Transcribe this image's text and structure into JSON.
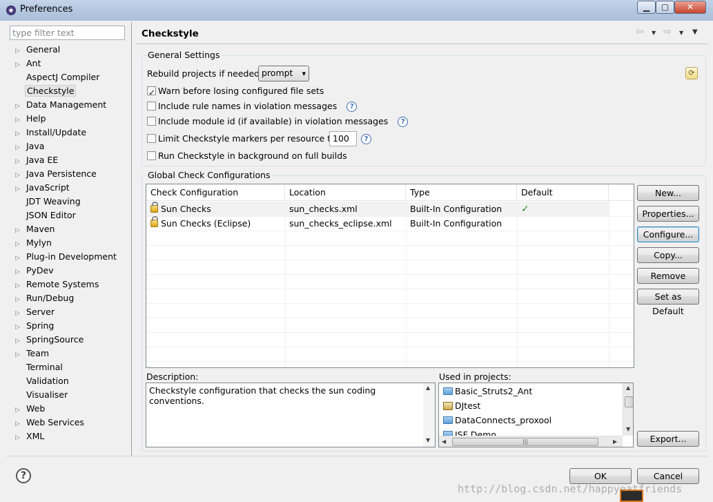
{
  "window": {
    "title": "Preferences"
  },
  "filter": {
    "placeholder": "type filter text"
  },
  "tree": [
    {
      "label": "General",
      "expandable": true
    },
    {
      "label": "Ant",
      "expandable": true
    },
    {
      "label": "AspectJ Compiler",
      "expandable": false
    },
    {
      "label": "Checkstyle",
      "expandable": false,
      "selected": true
    },
    {
      "label": "Data Management",
      "expandable": true
    },
    {
      "label": "Help",
      "expandable": true
    },
    {
      "label": "Install/Update",
      "expandable": true
    },
    {
      "label": "Java",
      "expandable": true
    },
    {
      "label": "Java EE",
      "expandable": true
    },
    {
      "label": "Java Persistence",
      "expandable": true
    },
    {
      "label": "JavaScript",
      "expandable": true
    },
    {
      "label": "JDT Weaving",
      "expandable": false
    },
    {
      "label": "JSON Editor",
      "expandable": false
    },
    {
      "label": "Maven",
      "expandable": true
    },
    {
      "label": "Mylyn",
      "expandable": true
    },
    {
      "label": "Plug-in Development",
      "expandable": true
    },
    {
      "label": "PyDev",
      "expandable": true
    },
    {
      "label": "Remote Systems",
      "expandable": true
    },
    {
      "label": "Run/Debug",
      "expandable": true
    },
    {
      "label": "Server",
      "expandable": true
    },
    {
      "label": "Spring",
      "expandable": true
    },
    {
      "label": "SpringSource",
      "expandable": true
    },
    {
      "label": "Team",
      "expandable": true
    },
    {
      "label": "Terminal",
      "expandable": false
    },
    {
      "label": "Validation",
      "expandable": false
    },
    {
      "label": "Visualiser",
      "expandable": false
    },
    {
      "label": "Web",
      "expandable": true
    },
    {
      "label": "Web Services",
      "expandable": true
    },
    {
      "label": "XML",
      "expandable": true
    }
  ],
  "page": {
    "title": "Checkstyle",
    "general": {
      "legend": "General Settings",
      "rebuild_label": "Rebuild projects if needed:",
      "rebuild_value": "prompt",
      "warn_label": "Warn before losing configured file sets",
      "warn_checked": true,
      "rule_names_label": "Include rule names in violation messages",
      "module_id_label": "Include module id (if available) in violation messages",
      "limit_label": "Limit Checkstyle markers per resource to",
      "limit_value": "100",
      "background_label": "Run Checkstyle in background on full builds"
    },
    "global": {
      "legend": "Global Check Configurations",
      "columns": [
        "Check Configuration",
        "Location",
        "Type",
        "Default"
      ],
      "rows": [
        {
          "name": "Sun Checks",
          "location": "sun_checks.xml",
          "type": "Built-In Configuration",
          "default": "✓"
        },
        {
          "name": "Sun Checks (Eclipse)",
          "location": "sun_checks_eclipse.xml",
          "type": "Built-In Configuration",
          "default": ""
        }
      ],
      "buttons": {
        "new": "New...",
        "properties": "Properties...",
        "configure": "Configure...",
        "copy": "Copy...",
        "remove": "Remove",
        "set_default": "Set as Default",
        "export": "Export..."
      },
      "description_label": "Description:",
      "description_text": "Checkstyle configuration that checks the sun coding conventions.",
      "used_label": "Used in projects:",
      "projects": [
        "Basic_Struts2_Ant",
        "DJtest",
        "DataConnects_proxool",
        "JSF Demo"
      ]
    }
  },
  "footer": {
    "ok": "OK",
    "cancel": "Cancel",
    "watermark": "http://blog.csdn.net/happyeatfriends"
  },
  "colors": {
    "titlebar": "#b7c9e2",
    "close_button": "#c7432c",
    "checkmark": "#2a8a2a"
  }
}
